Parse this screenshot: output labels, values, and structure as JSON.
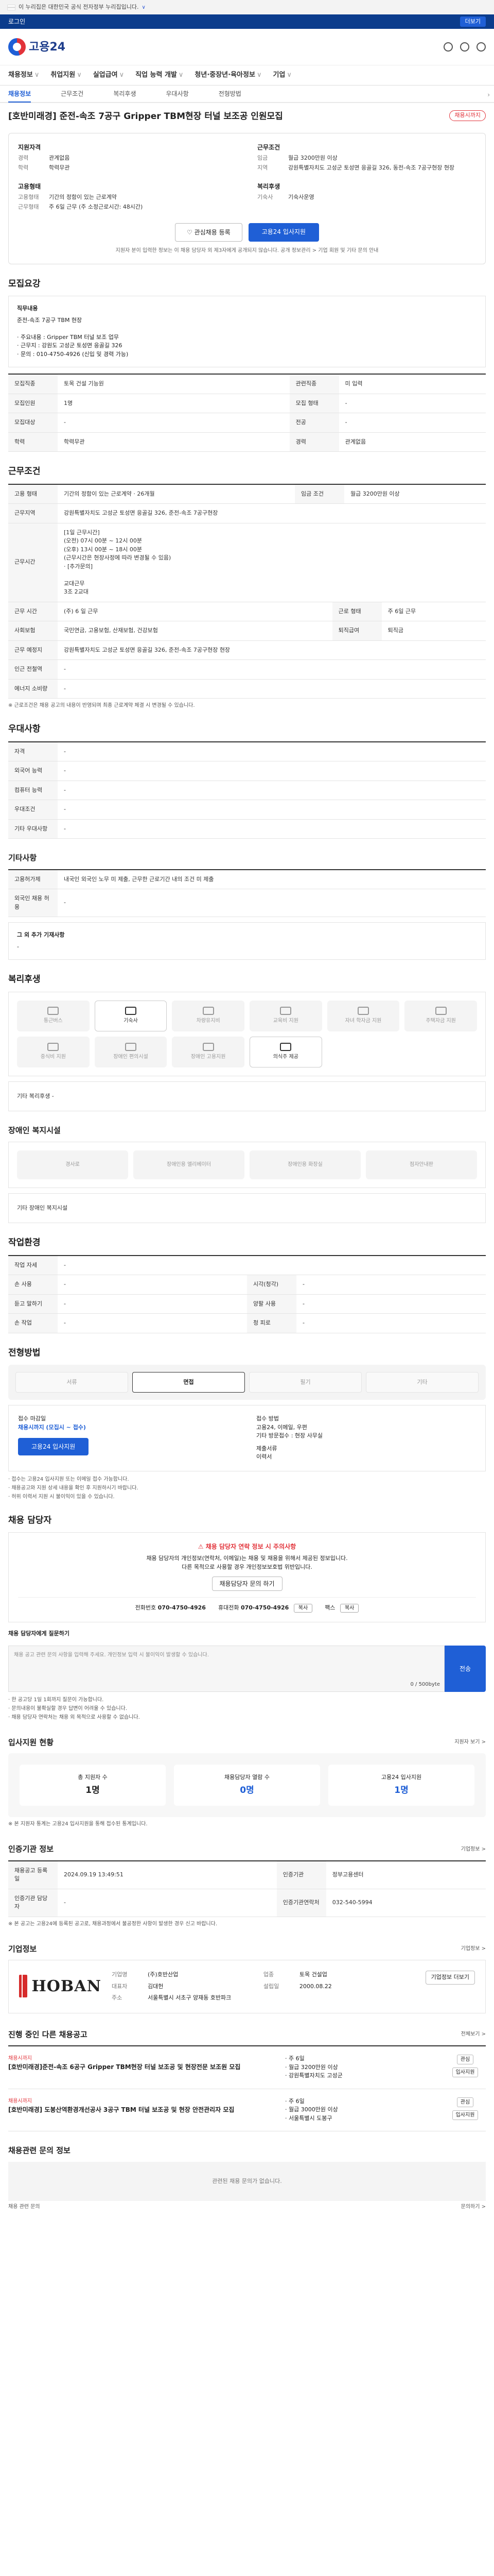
{
  "gov": {
    "text": "이 누리집은 대한민국 공식 전자정부 누리집입니다.",
    "toggle": "∨"
  },
  "uli": {
    "left": "로그인",
    "center": "",
    "btn": "더보기"
  },
  "header": {
    "logo": "고용24"
  },
  "gnb": [
    "채용정보",
    "취업지원",
    "실업급여",
    "직업 능력 개발",
    "청년·중장년·육아정보",
    "기업"
  ],
  "subnav": {
    "tabs": [
      "채용정보",
      "근무조건",
      "복리후생",
      "우대사항",
      "전형방법"
    ],
    "active": 0
  },
  "job": {
    "title": "[호반미래경] 준전-속조 7공구 Gripper TBM현장 터널 보조공 인원모집",
    "dday": "채용시까지",
    "summary": {
      "recruit_h": "지원자격",
      "recruit": [
        [
          "경력",
          "관계없음"
        ],
        [
          "학력",
          "학력무관"
        ]
      ],
      "cond_h": "근무조건",
      "cond": [
        [
          "임금",
          "월급 3200만원 이상"
        ],
        [
          "지역",
          "강원특별자치도 고성군 토성면 응골길 326, 동전-속조 7공구현장 현장"
        ]
      ],
      "type_h": "고용형태",
      "type": [
        [
          "고용형태",
          "기간의 정함이 있는 근로계약"
        ],
        [
          "근무형태",
          "주 6일 근무 (주 소정근로시간: 48시간)"
        ]
      ],
      "benefit_h": "복리후생",
      "benefit": [
        [
          "기숙사",
          "기숙사운영"
        ]
      ]
    },
    "actions": {
      "save": "관심채용 등록",
      "apply": "고용24 입사지원"
    },
    "apply_note": "지원자 분이 입력한 정보는 이 채용 담당자 외 제3자에게 공개되지 않습니다. 공개 정보관리 > 기업 회원 및 기타 문의 안내"
  },
  "section_summary": {
    "h": "모집요강",
    "desc_h": "직무내용",
    "desc": "준전-속조 7공구 TBM 현장\n\n· 주요내용 : Gripper TBM 터널 보조 업무\n· 근무지 : 강원도 고성군 토성면 응골길 326\n· 문의 : 010-4750-4926 (신입 및 경력 가능)",
    "rows": [
      [
        "모집직종",
        "토목 건설 기능원",
        "관련직종",
        "미 입력"
      ],
      [
        "모집인원",
        "1명",
        "모집 형태",
        "-"
      ],
      [
        "모집대상",
        "-",
        "전공",
        "-"
      ],
      [
        "학력",
        "학력무관",
        "경력",
        "관계없음"
      ]
    ]
  },
  "section_cond": {
    "h": "근무조건",
    "rows": [
      [
        "고용 형태",
        "기간의 정함이 있는 근로계약 · 26개월",
        "임금 조건",
        "월급 3200만원 이상"
      ],
      [
        "근무지역",
        "강원특별자치도 고성군 토성면 응골길 326, 준전-속조 7공구현장",
        "",
        ""
      ]
    ],
    "hours_h": "근무시간",
    "hours": "[1일 근무시간]\n(오전) 07시 00분 ~ 12시 00분\n(오후) 13시 00분 ~ 18시 00분\n(근무시간은 현장사정에 따라 변경될 수 있음)\n· [추가문의]\n\n교대근무\n3조 2교대",
    "rows2": [
      [
        "근무 시간",
        "(주) 6 일 근무",
        "근로 형태",
        "주 6일 근무"
      ],
      [
        "사회보험",
        "국민연금, 고용보험, 산재보험, 건강보험",
        "퇴직급여",
        "퇴직금"
      ],
      [
        "근무 예정지",
        "강원특별자치도 고성군 토성면 응골길 326, 준전-속조 7공구현장 현장",
        "",
        ""
      ],
      [
        "인근 전철역",
        "-",
        "",
        ""
      ],
      [
        "에너지 소비량",
        "-",
        "",
        ""
      ]
    ],
    "note": "※ 근로조건은 채용 공고의 내용이 반영되며 최종 근로계약 체결 시 변경될 수 있습니다."
  },
  "section_pref": {
    "h": "우대사항",
    "rows": [
      [
        "자격",
        "-"
      ],
      [
        "외국어 능력",
        "-"
      ],
      [
        "컴퓨터 능력",
        "-"
      ],
      [
        "우대조건",
        "-"
      ],
      [
        "기타 우대사항",
        "-"
      ]
    ]
  },
  "section_etc": {
    "h": "기타사항",
    "rows": [
      [
        "고용허가제",
        "내국인 외국인 노무 미 제출, 근무한 근로기간 내의 조건 미 제출"
      ],
      [
        "외국인 채용 허용",
        "-"
      ]
    ],
    "etc_h": "그 외 추가 기재사항",
    "etc": "-"
  },
  "section_welfare": {
    "h": "복리후생",
    "items": [
      "통근버스",
      "기숙사",
      "차량유지비",
      "교육비 지원",
      "자녀 학자금 지원",
      "주택자금 지원",
      "중식비 지원",
      "장애인 편의시설",
      "장애인 고용지원",
      "의식주 제공"
    ],
    "on": [
      1,
      9
    ],
    "note": "기타 복리후생",
    "note_val": "-"
  },
  "section_disabled": {
    "h": "장애인 복지시설",
    "items": [
      "경사로",
      "장애인용 엘리베이터",
      "장애인용 화장실",
      "점자안내판"
    ],
    "note": "기타 장애인 복지시설"
  },
  "section_env": {
    "h": "작업환경",
    "rows": [
      [
        "작업 자세",
        "-",
        "",
        ""
      ],
      [
        "손 사용",
        "-",
        "시각(청각)",
        "-"
      ],
      [
        "듣고 말하기",
        "-",
        "양팔 사용",
        "-"
      ],
      [
        "손 작업",
        "-",
        "청 피로",
        "-"
      ]
    ]
  },
  "section_proc": {
    "h": "전형방법",
    "tabs": [
      "서류",
      "면접",
      "필기",
      "기타"
    ],
    "active": 1,
    "left_h": "접수 마감일",
    "left": "채용시까지 (모집시 ~ 접수)",
    "apply_btn": "고용24 입사지원",
    "right_h": "접수 방법",
    "right": "고용24, 이메일, 우편\n기타 방문접수 : 현장 사무실",
    "right2": "제출서류",
    "right3": "이력서",
    "notes": [
      "· 접수는 고용24 입사지원 또는 이메일 접수 가능합니다.",
      "· 채용공고와 지원 상세 내용을 확인 후 지원하시기 바랍니다.",
      "· 허위 이력서 지원 시 불이익이 있을 수 있습니다."
    ]
  },
  "section_contact": {
    "h": "채용 담당자",
    "warn": "채용 담당자 연락 정보 시 주의사항",
    "desc": "채용 담당자의 개인정보(연락처, 이메일)는 채용 및 채용을 위해서 제공된 정보입니다.\n다른 목적으로 사용할 경우 개인정보보호법 위반입니다.",
    "link": "채용담당자 문의 하기",
    "tel_k": "전화번호",
    "tel": "070-4750-4926",
    "phone_k": "휴대전화",
    "phone": "070-4750-4926",
    "fax_k": "팩스",
    "email_k": "이메일",
    "copy1": "복사",
    "copy2": "복사",
    "qa_h": "채용 담당자에게 질문하기",
    "qa_ph": "채용 공고 관련 문의 사항을 입력해 주세요. 개인정보 입력 시 불이익이 발생할 수 있습니다.",
    "qa_count": "0 / 500byte",
    "send": "전송",
    "qa_notes": [
      "· 한 공고당 1일 1회까지 질문이 가능합니다.",
      "· 문의내용이 불확실할 경우 답변이 어려울 수 있습니다.",
      "· 채용 담당자 연락처는 채용 외 목적으로 사용할 수 없습니다."
    ]
  },
  "section_stats": {
    "h": "입사지원 현황",
    "more": "지원자 보기 >",
    "items": [
      {
        "k": "총 지원자 수",
        "v": "1명"
      },
      {
        "k": "채용담당자 열람 수",
        "v": "0명"
      },
      {
        "k": "고용24 입사지원",
        "v": "1명"
      }
    ],
    "note": "※ 본 지원자 통계는 고용24 입사지원을 통해 접수된 통계입니다."
  },
  "section_info": {
    "h": "인증기관 정보",
    "more": "기업정보 >",
    "rows": [
      [
        "채용공고 등록일",
        "2024.09.19 13:49:51",
        "인증기관",
        "정부고용센터"
      ],
      [
        "인증기관 담당자",
        "-",
        "인증기관연락처",
        "032-540-5994"
      ]
    ],
    "note": "※ 본 공고는 고용24에 등록된 공고로, 채용과정에서 불공정한 사항이 발생한 경우 신고 바랍니다."
  },
  "section_company": {
    "h": "기업정보",
    "more": "기업정보 >",
    "logo": "HOBAN",
    "rows": [
      [
        "기업명",
        "(주)호반산업",
        "업종",
        "토목 건설업"
      ],
      [
        "대표자",
        "김대헌",
        "설립일",
        "2000.08.22"
      ],
      [
        "주소",
        "서울특별시 서초구 양재동 호반파크",
        "",
        ""
      ]
    ],
    "btn": "기업정보 더보기"
  },
  "section_jobs": {
    "h": "진행 중인 다른 채용공고",
    "more": "전체보기 >",
    "items": [
      {
        "co": "채용시까지",
        "t": "[호반미래경]준전-속조 6공구 Gripper TBM현장 터널 보조공 및 현장전문 보조원 모집",
        "c1": "주 6일",
        "c2": "월급 3200만원 이상",
        "c3": "강원특별자치도 고성군",
        "btn1": "관심",
        "btn2": "입사지원"
      },
      {
        "co": "채용시까지",
        "t": "[호반미래경] 도봉산역환경개선공사 3공구 TBM 터널 보조공 및 현장 안전관리자 모집",
        "c1": "주 6일",
        "c2": "월급 3000만원 이상",
        "c3": "서울특별시 도봉구",
        "btn1": "관심",
        "btn2": "입사지원"
      }
    ]
  },
  "section_empty": {
    "h": "채용관련 문의 정보",
    "text": "관련된 채용 문의가 없습니다.",
    "inq": "채용 관련 문의",
    "inq2": "문의하기 >"
  }
}
